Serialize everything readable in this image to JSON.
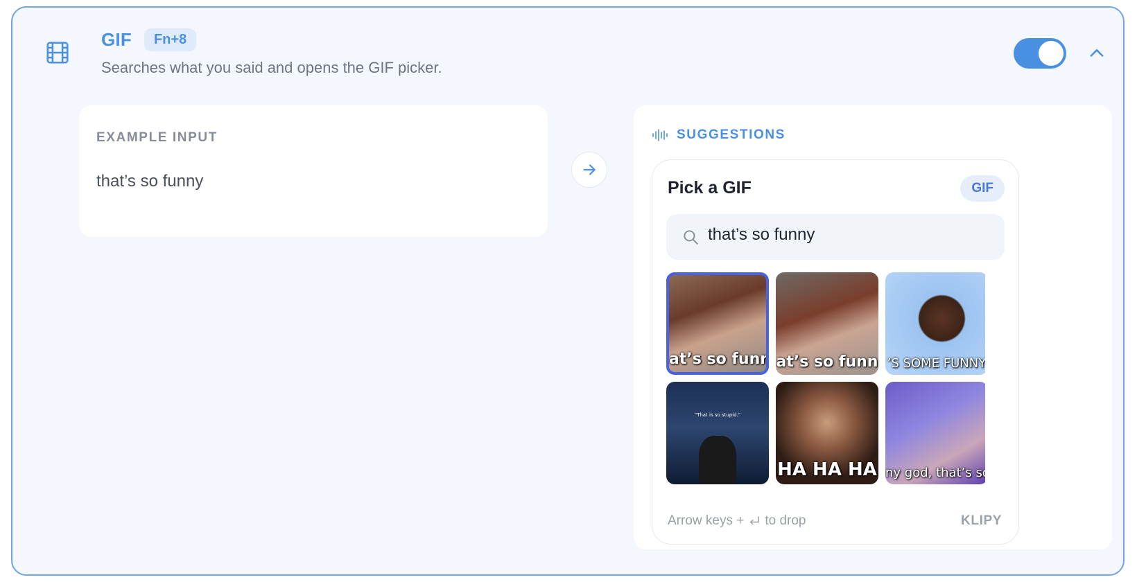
{
  "header": {
    "icon": "film-icon",
    "title": "GIF",
    "shortcut": "Fn+8",
    "subtitle": "Searches what you said and opens the GIF picker.",
    "toggle_on": true,
    "collapse_icon": "chevron-up-icon"
  },
  "example": {
    "label": "EXAMPLE INPUT",
    "text": "that’s so funny"
  },
  "arrow_icon": "arrow-right-icon",
  "suggestions": {
    "icon": "waveform-icon",
    "label": "SUGGESTIONS"
  },
  "picker": {
    "title": "Pick a GIF",
    "badge": "GIF",
    "search_value": "that’s so funny",
    "gifs": [
      {
        "caption": "at’s so funn",
        "selected": true
      },
      {
        "caption": "at’s so funn",
        "selected": false
      },
      {
        "caption": "’S SOME FUNNY",
        "selected": false
      },
      {
        "caption": "",
        "mini": "\"That is so stupid.\"",
        "selected": false
      },
      {
        "caption": "HA HA HA",
        "selected": false
      },
      {
        "caption": "ny god, that’s so",
        "selected": false
      },
      {
        "caption": "",
        "selected": false
      },
      {
        "caption": "",
        "selected": false
      },
      {
        "caption": "",
        "selected": false
      }
    ],
    "footer_prefix": "Arrow keys +",
    "footer_suffix": "to drop",
    "enter_icon": "return-key-icon",
    "provider": "KLIPY"
  },
  "colors": {
    "accent": "#4a90e2",
    "card_border": "#6fa3e6",
    "card_background": "#f4f8fe",
    "selected_border": "#4a62e2"
  }
}
